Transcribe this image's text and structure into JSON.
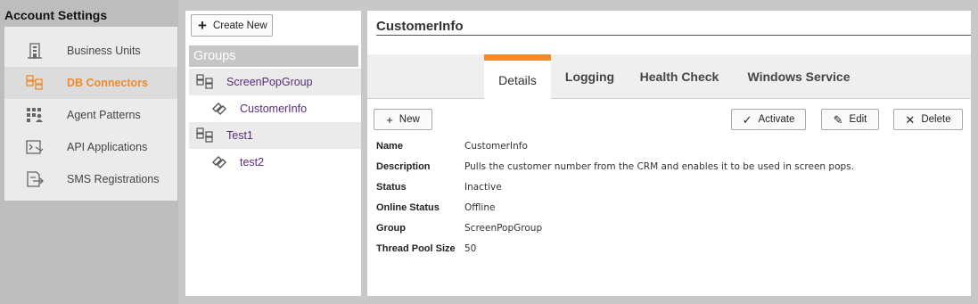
{
  "left_panel": {
    "title": "Account Settings",
    "items": [
      {
        "label": "Business Units",
        "icon": "building-icon",
        "active": false
      },
      {
        "label": "DB Connectors",
        "icon": "db-connector-icon",
        "active": true
      },
      {
        "label": "Agent Patterns",
        "icon": "agent-patterns-icon",
        "active": false
      },
      {
        "label": "API Applications",
        "icon": "api-applications-icon",
        "active": false
      },
      {
        "label": "SMS Registrations",
        "icon": "sms-registrations-icon",
        "active": false
      }
    ]
  },
  "groups_panel": {
    "create_button": "Create New",
    "header": "Groups",
    "items": [
      {
        "label": "ScreenPopGroup",
        "type": "group",
        "icon": "group-icon"
      },
      {
        "label": "CustomerInfo",
        "type": "connector",
        "icon": "connector-icon"
      },
      {
        "label": "Test1",
        "type": "group",
        "icon": "group-icon"
      },
      {
        "label": "test2",
        "type": "connector",
        "icon": "connector-icon"
      }
    ]
  },
  "main": {
    "title": "CustomerInfo",
    "tabs": [
      {
        "label": "Details",
        "active": true
      },
      {
        "label": "Logging",
        "active": false
      },
      {
        "label": "Health Check",
        "active": false
      },
      {
        "label": "Windows Service",
        "active": false
      }
    ],
    "buttons": {
      "new": "New",
      "activate": "Activate",
      "edit": "Edit",
      "delete": "Delete"
    },
    "details": [
      {
        "key": "Name",
        "value": "CustomerInfo"
      },
      {
        "key": "Description",
        "value": "Pulls the customer number from the CRM and enables it to be used in screen pops."
      },
      {
        "key": "Status",
        "value": "Inactive"
      },
      {
        "key": "Online Status",
        "value": "Offline"
      },
      {
        "key": "Group",
        "value": "ScreenPopGroup"
      },
      {
        "key": "Thread Pool Size",
        "value": "50"
      }
    ]
  },
  "colors": {
    "accent": "#f08a2c",
    "link": "#5a2b80",
    "panel_bg": "#ebebeb"
  }
}
